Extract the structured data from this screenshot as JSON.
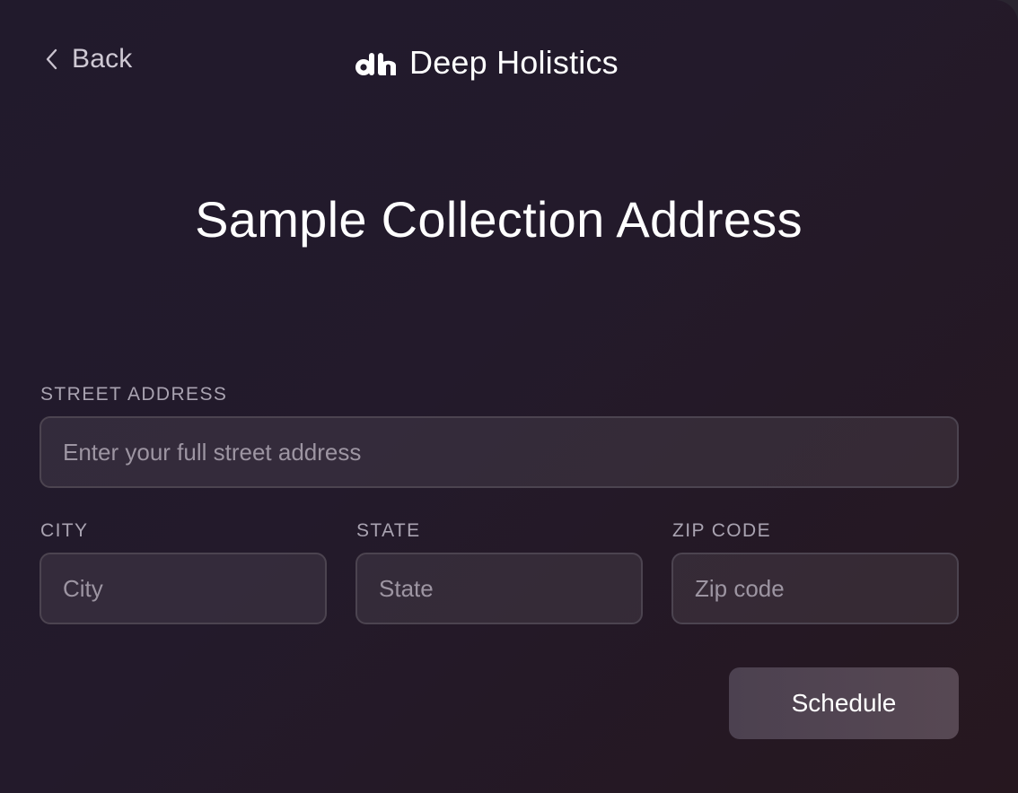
{
  "header": {
    "back_label": "Back",
    "back_icon": "chevron-left-icon",
    "logo_icon": "deep-holistics-logo",
    "brand_name": "Deep Holistics"
  },
  "form": {
    "title": "Sample Collection Address",
    "street": {
      "label": "STREET ADDRESS",
      "placeholder": "Enter your full street address",
      "value": ""
    },
    "city": {
      "label": "CITY",
      "placeholder": "City",
      "value": ""
    },
    "state": {
      "label": "STATE",
      "placeholder": "State",
      "value": ""
    },
    "zip": {
      "label": "ZIP CODE",
      "placeholder": "Zip code",
      "value": ""
    },
    "submit_label": "Schedule"
  },
  "colors": {
    "background_start": "#211a2c",
    "background_end": "#26171f",
    "text_primary": "#ffffff",
    "label": "#a9a3b1",
    "input_border": "#4c4450",
    "button": "#534752"
  }
}
